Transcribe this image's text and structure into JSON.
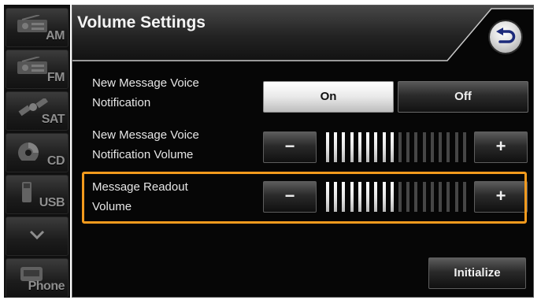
{
  "sidebar": {
    "items": [
      {
        "label": "AM",
        "icon": "am-radio-icon"
      },
      {
        "label": "FM",
        "icon": "fm-radio-icon"
      },
      {
        "label": "SAT",
        "icon": "satellite-icon"
      },
      {
        "label": "CD",
        "icon": "cd-icon"
      },
      {
        "label": "USB",
        "icon": "usb-icon"
      },
      {
        "label": "",
        "icon": "chevron-down-icon"
      },
      {
        "label": "Phone",
        "icon": "phone-icon"
      }
    ]
  },
  "header": {
    "title": "Volume Settings",
    "back_icon": "back-arrow-icon"
  },
  "settings": {
    "notification": {
      "label_line1": "New Message Voice",
      "label_line2": "Notification",
      "on_label": "On",
      "off_label": "Off",
      "selected": "On"
    },
    "notification_volume": {
      "label_line1": "New Message Voice",
      "label_line2": "Notification Volume",
      "minus_label": "−",
      "plus_label": "+",
      "level": 9,
      "max_level": 18
    },
    "readout_volume": {
      "label_line1": "Message Readout",
      "label_line2": "Volume",
      "minus_label": "−",
      "plus_label": "+",
      "level": 9,
      "max_level": 18
    }
  },
  "footer": {
    "initialize_label": "Initialize"
  },
  "colors": {
    "highlight": "#f39a1d",
    "panel_bg": "#060606",
    "text": "#e6e6e6"
  }
}
